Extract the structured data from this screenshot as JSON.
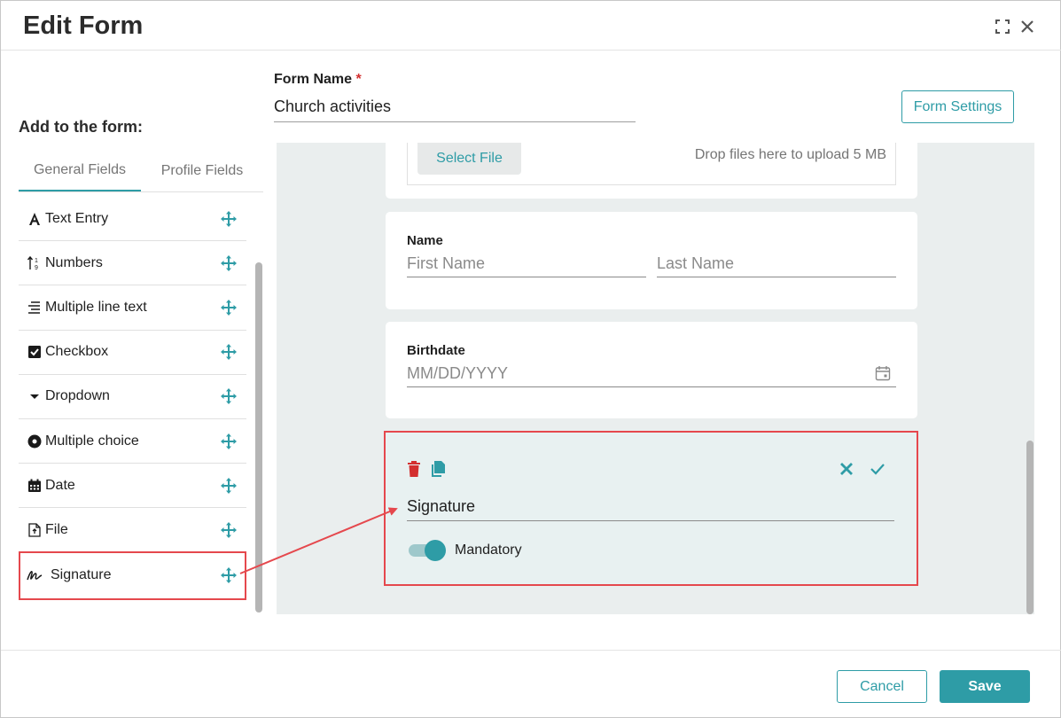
{
  "dialog": {
    "title": "Edit Form"
  },
  "sidebar": {
    "heading": "Add to the form:",
    "tabs": [
      {
        "label": "General Fields",
        "active": true
      },
      {
        "label": "Profile Fields",
        "active": false
      }
    ],
    "items": [
      {
        "label": "Text Entry",
        "icon": "text-entry-icon"
      },
      {
        "label": "Numbers",
        "icon": "numbers-icon"
      },
      {
        "label": "Multiple line text",
        "icon": "multiline-icon"
      },
      {
        "label": "Checkbox",
        "icon": "checkbox-icon"
      },
      {
        "label": "Dropdown",
        "icon": "dropdown-icon"
      },
      {
        "label": "Multiple choice",
        "icon": "radio-icon"
      },
      {
        "label": "Date",
        "icon": "calendar-icon"
      },
      {
        "label": "File",
        "icon": "file-icon"
      },
      {
        "label": "Signature",
        "icon": "signature-icon"
      }
    ]
  },
  "form": {
    "name_label": "Form Name",
    "required_mark": "*",
    "name_value": "Church activities",
    "settings_label": "Form Settings"
  },
  "canvas": {
    "file": {
      "select_label": "Select File",
      "drop_text": "Drop files here to upload 5 MB"
    },
    "name_field": {
      "label": "Name",
      "first_placeholder": "First Name",
      "last_placeholder": "Last Name"
    },
    "birthdate_field": {
      "label": "Birthdate",
      "placeholder": "MM/DD/YYYY"
    },
    "signature_field": {
      "value": "Signature",
      "mandatory_label": "Mandatory",
      "mandatory_on": true
    }
  },
  "footer": {
    "cancel_label": "Cancel",
    "save_label": "Save"
  },
  "colors": {
    "accent": "#2e9ca6",
    "highlight": "#e5484d",
    "delete": "#d32f2f"
  }
}
